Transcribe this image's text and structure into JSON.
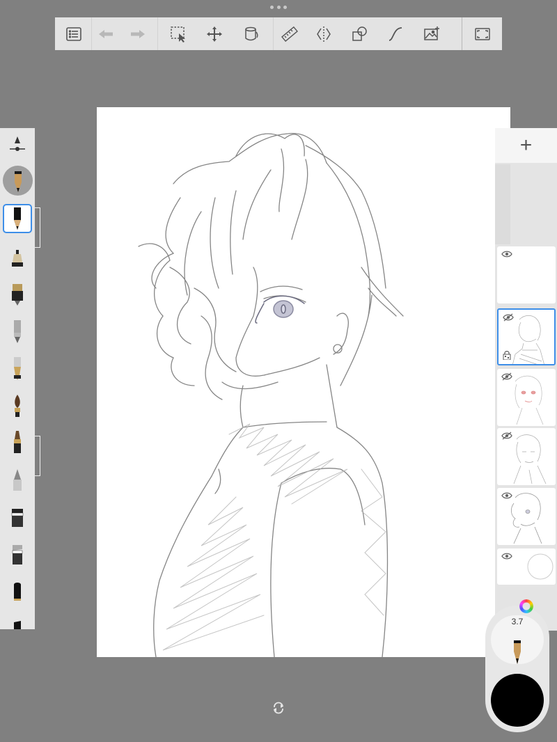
{
  "toolbar": {
    "items": [
      "list-icon",
      "undo-icon",
      "redo-icon",
      "selection-icon",
      "transform-icon",
      "fill-icon",
      "ruler-icon",
      "symmetry-icon",
      "shape-icon",
      "curve-icon",
      "image-icon",
      "fullscreen-icon"
    ]
  },
  "brushes": [
    "brush-size-icon",
    "pencil-brush",
    "airbrush",
    "ink-pen",
    "ballpoint-pen",
    "fountain-pen",
    "paint-brush",
    "marker",
    "eraser-soft",
    "smear-tool",
    "blender-tool",
    "flat-marker",
    "chisel-marker"
  ],
  "layers": {
    "add_label": "+",
    "items": [
      {
        "name": "layer-blank",
        "visible": true
      },
      {
        "name": "layer-active",
        "visible": false,
        "locked": true
      },
      {
        "name": "layer-color",
        "visible": false
      },
      {
        "name": "layer-sketch-2",
        "visible": false
      },
      {
        "name": "layer-sketch-1",
        "visible": true
      },
      {
        "name": "layer-background",
        "visible": true
      }
    ]
  },
  "puck": {
    "brush_size": "3.7",
    "color": "#000000"
  },
  "colors": {
    "accent": "#3d8ee8",
    "workspace": "#808080",
    "toolbar": "#e3e3e3"
  }
}
